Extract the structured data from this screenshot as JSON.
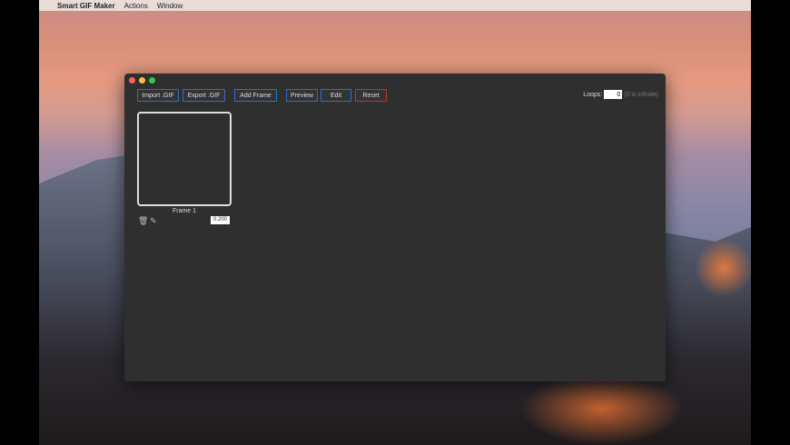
{
  "menubar": {
    "apple": "",
    "app": "Smart GIF Maker",
    "items": [
      "Actions",
      "Window"
    ]
  },
  "toolbar": {
    "import": "Import .GIF",
    "export": "Export .GIF",
    "add_frame": "Add Frame",
    "preview": "Preview",
    "edit": "Edit",
    "reset": "Reset"
  },
  "loops": {
    "label": "Loops:",
    "value": "0",
    "hint": "(0 is infinite)"
  },
  "frames": [
    {
      "label": "Frame 1",
      "duration": "0.200"
    }
  ],
  "colors": {
    "accent": "#2d6fc0",
    "danger": "#c0302f"
  }
}
